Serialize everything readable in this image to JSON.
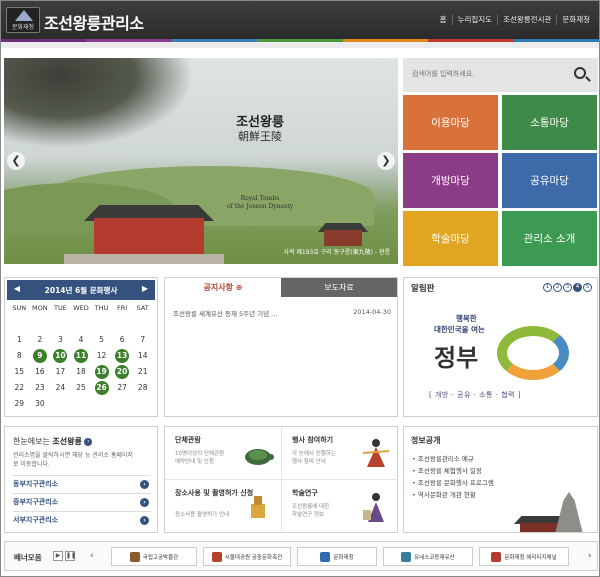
{
  "header": {
    "logo_text": "문화재청",
    "title": "조선왕릉관리소",
    "nav": [
      "홈",
      "누리집지도",
      "조선왕릉전시관",
      "문화재청"
    ],
    "strip_colors": [
      "#6b2f7a",
      "#8c3b8f",
      "#3a7fb6",
      "#4a9a3a",
      "#e08a1e",
      "#c23b2a",
      "#2e7bb5"
    ]
  },
  "hero": {
    "title": "조선왕릉",
    "subtitle": "朝鮮王陵",
    "en_line1": "Royal Tombs",
    "en_line2": "of the Joseon Dynasty",
    "caption": "사적 제193호 구리 동구릉(東九陵) - 현릉",
    "prev_icon": "chevron-left-icon",
    "next_icon": "chevron-right-icon"
  },
  "search": {
    "placeholder": "검색어를 입력하세요."
  },
  "tiles": [
    {
      "label": "이용마당",
      "color": "#d9723a"
    },
    {
      "label": "소통마당",
      "color": "#3e8a49"
    },
    {
      "label": "개방마당",
      "color": "#8c3b86"
    },
    {
      "label": "공유마당",
      "color": "#3d6aa8"
    },
    {
      "label": "학술마당",
      "color": "#e2a522"
    },
    {
      "label": "관리소 소개",
      "color": "#3c9a52"
    }
  ],
  "calendar": {
    "title": "2014년 6월 문화행사",
    "days": [
      "SUN",
      "MON",
      "TUE",
      "WED",
      "THU",
      "FRI",
      "SAT"
    ],
    "weeks": [
      [
        "",
        "",
        "",
        "",
        "",
        "",
        ""
      ],
      [
        "1",
        "2",
        "3",
        "4",
        "5",
        "6",
        "7"
      ],
      [
        "8",
        "9",
        "10",
        "11",
        "12",
        "13",
        "14"
      ],
      [
        "15",
        "16",
        "17",
        "18",
        "19",
        "20",
        "21"
      ],
      [
        "22",
        "23",
        "24",
        "25",
        "26",
        "27",
        "28"
      ],
      [
        "29",
        "30",
        "",
        "",
        "",
        "",
        ""
      ]
    ],
    "event_days": [
      "9",
      "10",
      "11",
      "13",
      "19",
      "20",
      "26"
    ]
  },
  "notice": {
    "tab_active": "공지사항",
    "tab_inactive": "보도자료",
    "item": {
      "title": "조선왕릉 세계유산 등재 5주년 기념 ...",
      "date": "2014-04-30"
    }
  },
  "board": {
    "title": "알림판",
    "pages": [
      "1",
      "2",
      "3",
      "4",
      "5"
    ],
    "active_page": 4,
    "line1": "행복한",
    "line2": "대한민국을 여는",
    "line3": "정부",
    "line4": "[ 개방 · 공유 · 소통 · 협력 ]"
  },
  "guide": {
    "title_prefix": "한눈에보는",
    "title_bold": "조선왕릉",
    "desc1": "관리소명을 클릭하시면 해당 능 관리소 홈페이지",
    "desc2": "로 이동합니다.",
    "links": [
      "동부지구관리소",
      "중부지구관리소",
      "서부지구관리소"
    ]
  },
  "services": [
    {
      "title": "단체관람",
      "line1": "10명이상의 단체관람",
      "line2": "예약안내 및 신청"
    },
    {
      "title": "행사 참여하기",
      "line1": "각 능에서 진행하는",
      "line2": "행사 참여 안내"
    },
    {
      "title": "장소사용 및 촬영허가 신청",
      "line1": "장소사용 촬영허가 안내",
      "line2": ""
    },
    {
      "title": "학술연구",
      "line1": "조선왕릉에 대한",
      "line2": "학술연구 정보"
    }
  ],
  "info": {
    "title": "정보공개",
    "items": [
      "조선왕릉관리소 예규",
      "조선왕릉 체험행사 일정",
      "조선왕릉 문화행사 프로그램",
      "역사문화관 개관 현황"
    ]
  },
  "banners": {
    "label": "배너모음",
    "items": [
      {
        "text": "국립고궁박물관",
        "color": "#8c5a2a"
      },
      {
        "text": "서울대공원 궁중문화축전",
        "color": "#b5422a"
      },
      {
        "text": "문화재청",
        "color": "#2e6bb0"
      },
      {
        "text": "유네스코등재유산",
        "color": "#3a7f9a"
      },
      {
        "text": "문화재청 헤리티지채널",
        "color": "#b33c2e"
      }
    ]
  }
}
